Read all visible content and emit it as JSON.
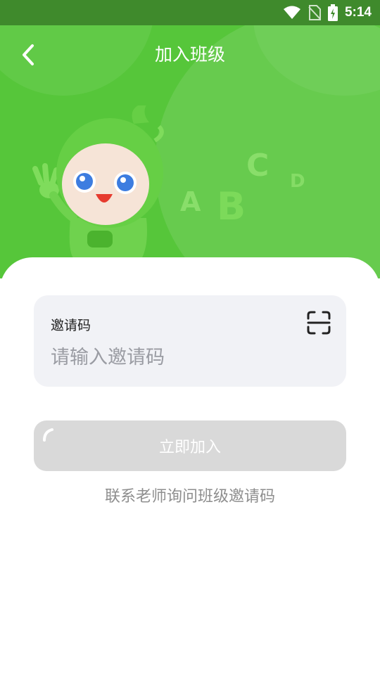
{
  "status_bar": {
    "time": "5:14",
    "icons": [
      "wifi-icon",
      "no-sim-icon",
      "battery-charging-icon"
    ]
  },
  "nav": {
    "title": "加入班级",
    "back_icon": "chevron-left-icon"
  },
  "decor": {
    "letters": [
      "A",
      "B",
      "C",
      "D"
    ]
  },
  "form": {
    "label": "邀请码",
    "placeholder": "请输入邀请码",
    "value": "",
    "scan_icon": "scan-icon"
  },
  "actions": {
    "join_label": "立即加入"
  },
  "hint": "联系老师询问班级邀请码",
  "colors": {
    "header_green": "#56c63a",
    "status_bar": "#3f8a2c",
    "input_bg": "#f1f2f6",
    "button_disabled": "#d9d9d9",
    "hint_text": "#8e8e8e"
  }
}
